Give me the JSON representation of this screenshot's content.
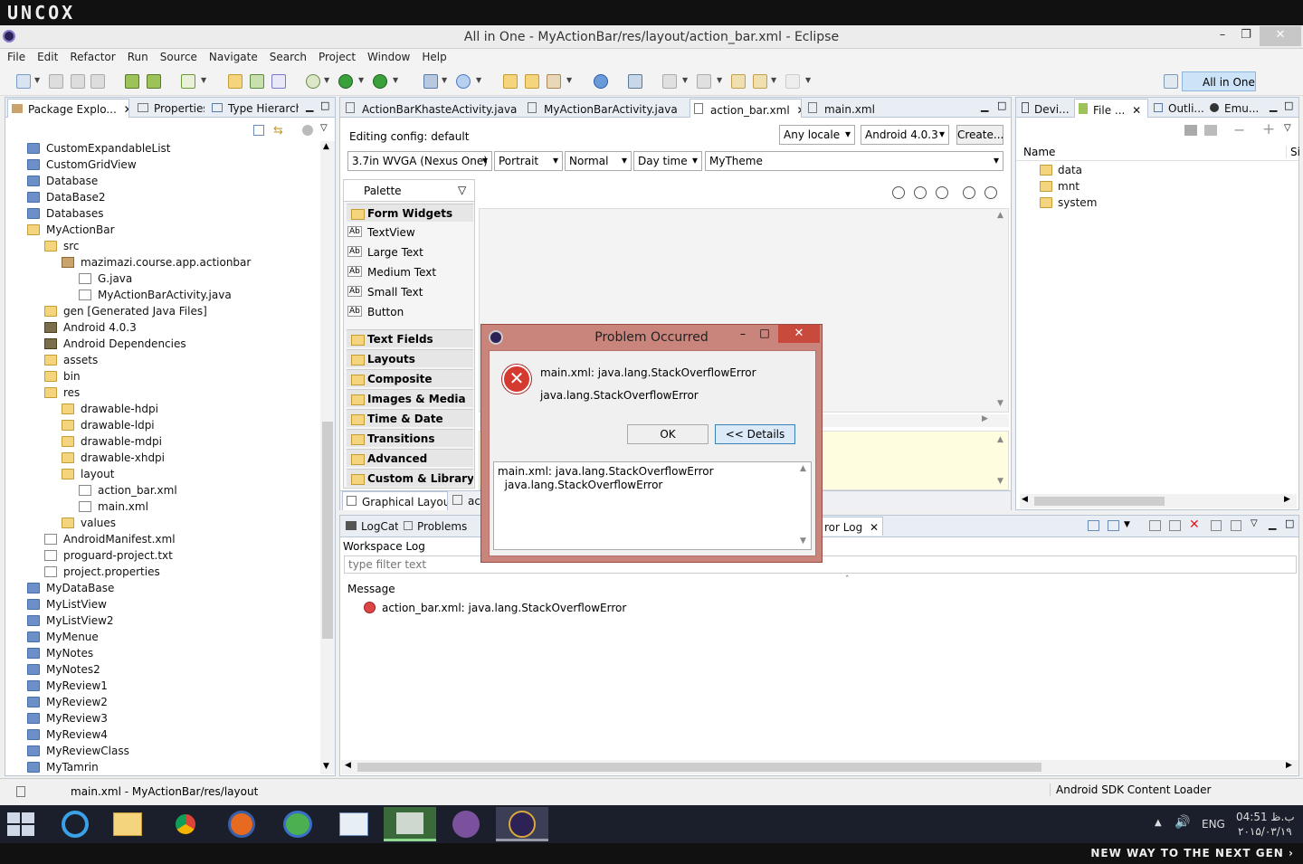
{
  "brand": "UNCOX",
  "window": {
    "title": "All in One - MyActionBar/res/layout/action_bar.xml - Eclipse",
    "min": "–",
    "max": "❐",
    "close": "✕"
  },
  "menu": [
    "File",
    "Edit",
    "Refactor",
    "Run",
    "Source",
    "Navigate",
    "Search",
    "Project",
    "Window",
    "Help"
  ],
  "perspective": "All in One",
  "left_tabs": {
    "package": "Package Explo...",
    "properties": "Properties",
    "hierarchy": "Type Hierarchy"
  },
  "tree": [
    {
      "label": "CustomExpandableList",
      "depth": 0,
      "icon": "folder"
    },
    {
      "label": "CustomGridView",
      "depth": 0,
      "icon": "folder"
    },
    {
      "label": "Database",
      "depth": 0,
      "icon": "folder"
    },
    {
      "label": "DataBase2",
      "depth": 0,
      "icon": "folder"
    },
    {
      "label": "Databases",
      "depth": 0,
      "icon": "folder"
    },
    {
      "label": "MyActionBar",
      "depth": 0,
      "icon": "ofolder"
    },
    {
      "label": "src",
      "depth": 1,
      "icon": "ofolder"
    },
    {
      "label": "mazimazi.course.app.actionbar",
      "depth": 2,
      "icon": "pkg"
    },
    {
      "label": "G.java",
      "depth": 3,
      "icon": "file"
    },
    {
      "label": "MyActionBarActivity.java",
      "depth": 3,
      "icon": "file"
    },
    {
      "label": "gen [Generated Java Files]",
      "depth": 1,
      "icon": "ofolder"
    },
    {
      "label": "Android 4.0.3",
      "depth": 1,
      "icon": "lib"
    },
    {
      "label": "Android Dependencies",
      "depth": 1,
      "icon": "lib"
    },
    {
      "label": "assets",
      "depth": 1,
      "icon": "ofolder"
    },
    {
      "label": "bin",
      "depth": 1,
      "icon": "ofolder"
    },
    {
      "label": "res",
      "depth": 1,
      "icon": "ofolder"
    },
    {
      "label": "drawable-hdpi",
      "depth": 2,
      "icon": "ofolder"
    },
    {
      "label": "drawable-ldpi",
      "depth": 2,
      "icon": "ofolder"
    },
    {
      "label": "drawable-mdpi",
      "depth": 2,
      "icon": "ofolder"
    },
    {
      "label": "drawable-xhdpi",
      "depth": 2,
      "icon": "ofolder"
    },
    {
      "label": "layout",
      "depth": 2,
      "icon": "ofolder"
    },
    {
      "label": "action_bar.xml",
      "depth": 3,
      "icon": "file"
    },
    {
      "label": "main.xml",
      "depth": 3,
      "icon": "file"
    },
    {
      "label": "values",
      "depth": 2,
      "icon": "ofolder"
    },
    {
      "label": "AndroidManifest.xml",
      "depth": 1,
      "icon": "file"
    },
    {
      "label": "proguard-project.txt",
      "depth": 1,
      "icon": "file"
    },
    {
      "label": "project.properties",
      "depth": 1,
      "icon": "file"
    },
    {
      "label": "MyDataBase",
      "depth": 0,
      "icon": "folder"
    },
    {
      "label": "MyListView",
      "depth": 0,
      "icon": "folder"
    },
    {
      "label": "MyListView2",
      "depth": 0,
      "icon": "folder"
    },
    {
      "label": "MyMenue",
      "depth": 0,
      "icon": "folder"
    },
    {
      "label": "MyNotes",
      "depth": 0,
      "icon": "folder"
    },
    {
      "label": "MyNotes2",
      "depth": 0,
      "icon": "folder"
    },
    {
      "label": "MyReview1",
      "depth": 0,
      "icon": "folder"
    },
    {
      "label": "MyReview2",
      "depth": 0,
      "icon": "folder"
    },
    {
      "label": "MyReview3",
      "depth": 0,
      "icon": "folder"
    },
    {
      "label": "MyReview4",
      "depth": 0,
      "icon": "folder"
    },
    {
      "label": "MyReviewClass",
      "depth": 0,
      "icon": "folder"
    },
    {
      "label": "MyTamrin",
      "depth": 0,
      "icon": "folder"
    }
  ],
  "editor_tabs": [
    "ActionBarKhasteActivity.java",
    "MyActionBarActivity.java",
    "action_bar.xml",
    "main.xml"
  ],
  "config": {
    "label": "Editing config:  default",
    "locale": "Any locale",
    "api": "Android 4.0.3",
    "create": "Create...",
    "device": "3.7in WVGA (Nexus One)",
    "orientation": "Portrait",
    "mode": "Normal",
    "time": "Day time",
    "theme": "MyTheme"
  },
  "palette": {
    "title": "Palette",
    "form_widgets": "Form Widgets",
    "items": [
      "TextView",
      "Large Text",
      "Medium Text",
      "Small Text",
      "Button"
    ],
    "categories": [
      "Text Fields",
      "Layouts",
      "Composite",
      "Images & Media",
      "Time & Date",
      "Transitions",
      "Advanced",
      "Custom & Library Views"
    ]
  },
  "bottom_editor_tabs": {
    "graphical": "Graphical Layout",
    "source": "ac"
  },
  "right_tabs": [
    "Devi...",
    "File ...",
    "Outli...",
    "Emu..."
  ],
  "file_explorer": {
    "col_name": "Name",
    "col_size": "Si",
    "items": [
      "data",
      "mnt",
      "system"
    ]
  },
  "log_tabs": {
    "logcat": "LogCat",
    "problems": "Problems",
    "errorlog": "ror Log"
  },
  "log": {
    "title": "Workspace Log",
    "filter_placeholder": "type filter text",
    "col_message": "Message",
    "entries": [
      "action_bar.xml: java.lang.StackOverflowError"
    ]
  },
  "dialog": {
    "title": "Problem Occurred",
    "message": "main.xml: java.lang.StackOverflowError",
    "detail": "java.lang.StackOverflowError",
    "ok": "OK",
    "details": "<< Details",
    "details_text_1": "main.xml: java.lang.StackOverflowError",
    "details_text_2": "  java.lang.StackOverflowError"
  },
  "status": {
    "left": "main.xml - MyActionBar/res/layout",
    "right": "Android SDK Content Loader"
  },
  "taskbar": {
    "lang": "ENG",
    "time": "04:51 ب.ظ",
    "date": "۲۰۱۵/۰۳/۱۹"
  },
  "footer": "NEW WAY TO THE NEXT GEN"
}
